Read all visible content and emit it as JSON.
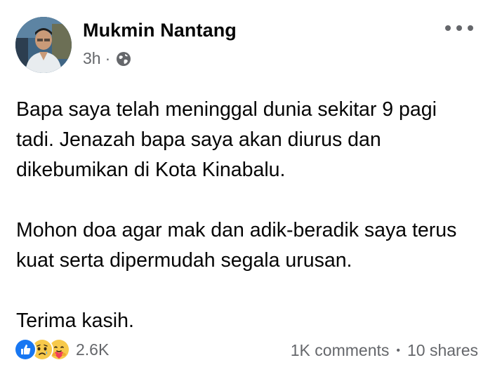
{
  "post": {
    "author": "Mukmin Nantang",
    "time": "3h",
    "meta_separator": "·",
    "privacy_icon": "globe-icon",
    "more_icon": "more-options-icon",
    "paragraphs": [
      "Bapa saya telah meninggal dunia sekitar 9 pagi tadi. Jenazah bapa saya akan diurus dan dikebumikan di Kota Kinabalu.",
      "Mohon doa agar mak dan adik-beradik saya terus kuat serta dipermudah segala urusan.",
      "Terima kasih."
    ],
    "reactions": {
      "icons": [
        "like-reaction-icon",
        "sad-reaction-icon",
        "care-reaction-icon"
      ],
      "count": "2.6K"
    },
    "comments": "1K comments",
    "stats_separator": "•",
    "shares": "10 shares"
  },
  "colors": {
    "text": "#050505",
    "secondary": "#65676b",
    "like_blue": "#1877f2",
    "sad_yellow": "#f7c94b"
  }
}
